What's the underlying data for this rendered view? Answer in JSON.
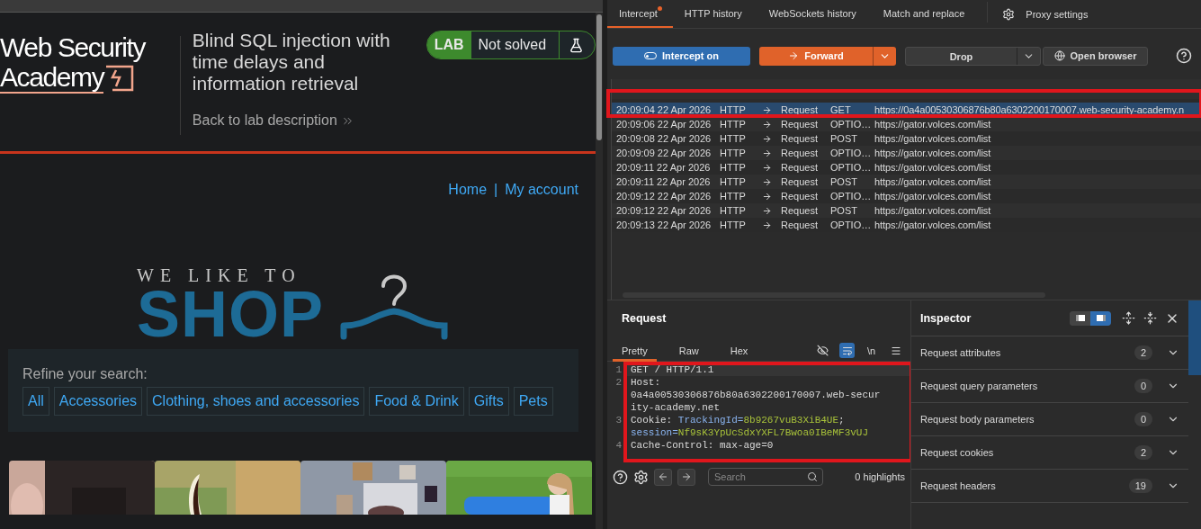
{
  "browser_pane": {
    "logo": {
      "line_1": "Web Security",
      "line_2": "Academy"
    },
    "lab_title": "Blind SQL injection with time delays and information retrieval",
    "back_link": "Back to lab description",
    "lab_status": {
      "label": "LAB",
      "status": "Not solved",
      "solved": false
    },
    "nav": [
      {
        "label": "Home"
      },
      {
        "label": "My account"
      }
    ],
    "nav_separator": "|",
    "shop_logo": {
      "tagline": "WE LIKE TO",
      "name": "SHOP"
    },
    "filter": {
      "label": "Refine your search:",
      "categories": [
        {
          "label": "All"
        },
        {
          "label": "Accessories"
        },
        {
          "label": "Clothing, shoes and accessories"
        },
        {
          "label": "Food & Drink"
        },
        {
          "label": "Gifts"
        },
        {
          "label": "Pets"
        }
      ]
    }
  },
  "proxy": {
    "tabs": [
      {
        "label": "Intercept",
        "selected": true,
        "notification": true
      },
      {
        "label": "HTTP history",
        "selected": false,
        "notification": false
      },
      {
        "label": "WebSockets history",
        "selected": false,
        "notification": false
      },
      {
        "label": "Match and replace",
        "selected": false,
        "notification": false
      }
    ],
    "settings_tab": "Proxy settings",
    "toolbar": {
      "intercept": {
        "label": "Intercept on",
        "on": true
      },
      "forward": "Forward",
      "drop": "Drop",
      "open_browser": "Open browser"
    },
    "history": {
      "rows": [
        {
          "time": "20:09:04 22 Apr 2026",
          "type": "HTTP",
          "direction": "Request",
          "method": "GET",
          "url": "https://0a4a00530306876b80a6302200170007.web-security-academy.n",
          "selected": true
        },
        {
          "time": "20:09:06 22 Apr 2026",
          "type": "HTTP",
          "direction": "Request",
          "method": "OPTIO…",
          "url": "https://gator.volces.com/list",
          "selected": false
        },
        {
          "time": "20:09:08 22 Apr 2026",
          "type": "HTTP",
          "direction": "Request",
          "method": "POST",
          "url": "https://gator.volces.com/list",
          "selected": false
        },
        {
          "time": "20:09:09 22 Apr 2026",
          "type": "HTTP",
          "direction": "Request",
          "method": "OPTIO…",
          "url": "https://gator.volces.com/list",
          "selected": false
        },
        {
          "time": "20:09:11 22 Apr 2026",
          "type": "HTTP",
          "direction": "Request",
          "method": "OPTIO…",
          "url": "https://gator.volces.com/list",
          "selected": false
        },
        {
          "time": "20:09:11 22 Apr 2026",
          "type": "HTTP",
          "direction": "Request",
          "method": "POST",
          "url": "https://gator.volces.com/list",
          "selected": false
        },
        {
          "time": "20:09:12 22 Apr 2026",
          "type": "HTTP",
          "direction": "Request",
          "method": "OPTIO…",
          "url": "https://gator.volces.com/list",
          "selected": false
        },
        {
          "time": "20:09:12 22 Apr 2026",
          "type": "HTTP",
          "direction": "Request",
          "method": "POST",
          "url": "https://gator.volces.com/list",
          "selected": false
        },
        {
          "time": "20:09:13 22 Apr 2026",
          "type": "HTTP",
          "direction": "Request",
          "method": "OPTIO…",
          "url": "https://gator.volces.com/list",
          "selected": false
        }
      ]
    },
    "request": {
      "title": "Request",
      "tabs": [
        {
          "label": "Pretty",
          "selected": true
        },
        {
          "label": "Raw",
          "selected": false
        },
        {
          "label": "Hex",
          "selected": false
        }
      ],
      "wrap_on": true,
      "newline_toggle": "\\n",
      "lines": [
        {
          "number": "1",
          "rows": [
            [
              {
                "kind": "plain",
                "text": "GET / HTTP/1.1"
              }
            ]
          ]
        },
        {
          "number": "2",
          "rows": [
            [
              {
                "kind": "plain",
                "text": "Host:"
              }
            ],
            [
              {
                "kind": "plain",
                "text": "0a4a00530306876b80a6302200170007.web-secur"
              }
            ],
            [
              {
                "kind": "plain",
                "text": "ity-academy.net"
              }
            ]
          ]
        },
        {
          "number": "3",
          "rows": [
            [
              {
                "kind": "plain",
                "text": "Cookie: "
              },
              {
                "kind": "key",
                "text": "TrackingId="
              },
              {
                "kind": "value",
                "text": "8b9267vuB3XiB4UE"
              },
              {
                "kind": "plain",
                "text": ";"
              }
            ],
            [
              {
                "kind": "key",
                "text": "session="
              },
              {
                "kind": "value",
                "text": "Nf9sK3YpUcSdxYXFL7Bwoa0IBeMF3vUJ"
              }
            ]
          ]
        },
        {
          "number": "4",
          "rows": [
            [
              {
                "kind": "plain",
                "text": "Cache-Control: max-age=0"
              }
            ]
          ]
        }
      ],
      "search": {
        "placeholder": "Search"
      },
      "highlights": "0 highlights"
    },
    "inspector": {
      "title": "Inspector",
      "layout_buttons": [
        {
          "selected": false
        },
        {
          "selected": true
        }
      ],
      "sections": [
        {
          "label": "Request attributes",
          "count": "2",
          "expanded": false
        },
        {
          "label": "Request query parameters",
          "count": "0",
          "expanded": false
        },
        {
          "label": "Request body parameters",
          "count": "0",
          "expanded": false
        },
        {
          "label": "Request cookies",
          "count": "2",
          "expanded": false
        },
        {
          "label": "Request headers",
          "count": "19",
          "expanded": false
        }
      ]
    }
  }
}
